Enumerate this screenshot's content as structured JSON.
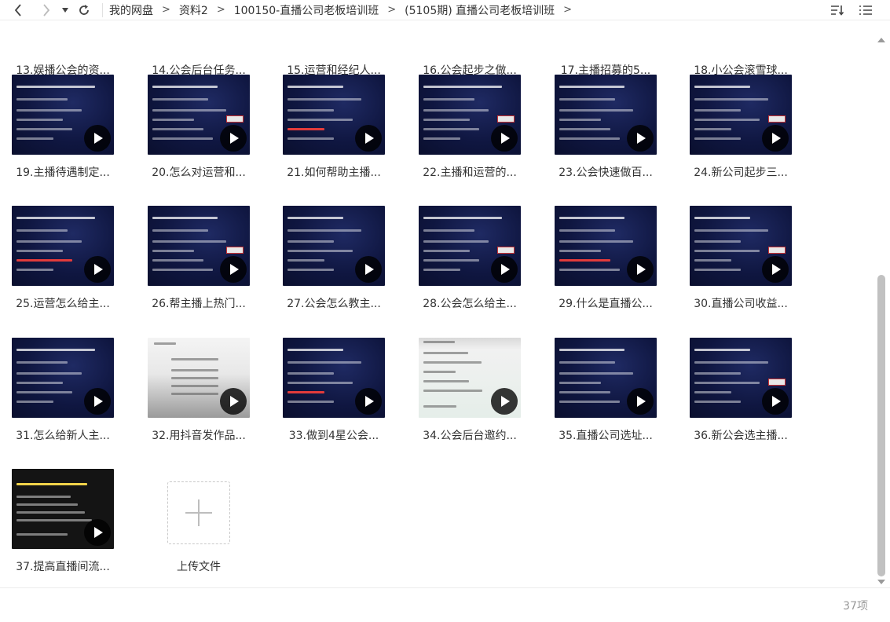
{
  "breadcrumb": [
    "我的网盘",
    "资料2",
    "100150-直播公司老板培训班",
    "(5105期) 直播公司老板培训班"
  ],
  "breadcrumb_separator": ">",
  "icons": {
    "back": "arrow-left-icon",
    "forward": "arrow-right-icon",
    "dropdown": "caret-down-icon",
    "refresh": "refresh-icon",
    "sort": "sort-icon",
    "list_view": "list-view-icon",
    "play": "play-icon",
    "upload": "plus-icon"
  },
  "files": [
    {
      "name": "13.娱播公会的资...",
      "thumb": "dark"
    },
    {
      "name": "14.公会后台任务...",
      "thumb": "dark"
    },
    {
      "name": "15.运营和经纪人...",
      "thumb": "dark"
    },
    {
      "name": "16.公会起步之做...",
      "thumb": "dark"
    },
    {
      "name": "17.主播招募的5...",
      "thumb": "dark"
    },
    {
      "name": "18.小公会滚雪球...",
      "thumb": "dark"
    },
    {
      "name": "19.主播待遇制定...",
      "thumb": "dark"
    },
    {
      "name": "20.怎么对运营和...",
      "thumb": "dark"
    },
    {
      "name": "21.如何帮助主播...",
      "thumb": "dark"
    },
    {
      "name": "22.主播和运营的...",
      "thumb": "dark"
    },
    {
      "name": "23.公会快速做百...",
      "thumb": "dark"
    },
    {
      "name": "24.新公司起步三...",
      "thumb": "dark"
    },
    {
      "name": "25.运营怎么给主...",
      "thumb": "dark"
    },
    {
      "name": "26.帮主播上热门...",
      "thumb": "dark"
    },
    {
      "name": "27.公会怎么教主...",
      "thumb": "dark"
    },
    {
      "name": "28.公会怎么给主...",
      "thumb": "dark"
    },
    {
      "name": "29.什么是直播公...",
      "thumb": "dark"
    },
    {
      "name": "30.直播公司收益...",
      "thumb": "dark"
    },
    {
      "name": "31.怎么给新人主...",
      "thumb": "dark"
    },
    {
      "name": "32.用抖音发作品...",
      "thumb": "photo"
    },
    {
      "name": "33.做到4星公会...",
      "thumb": "dark"
    },
    {
      "name": "34.公会后台邀约...",
      "thumb": "screen"
    },
    {
      "name": "35.直播公司选址...",
      "thumb": "dark"
    },
    {
      "name": "36.新公会选主播...",
      "thumb": "dark"
    },
    {
      "name": "37.提高直播间流...",
      "thumb": "black"
    }
  ],
  "upload": {
    "label": "上传文件"
  },
  "footer": {
    "count": "37项"
  },
  "colors": {
    "thumb_dark": "#0f1640",
    "text": "#333333",
    "muted": "#999999",
    "scroll_thumb": "#c1c1c1"
  },
  "scroll": {
    "position": 0.39,
    "visible_fraction": 0.57
  }
}
